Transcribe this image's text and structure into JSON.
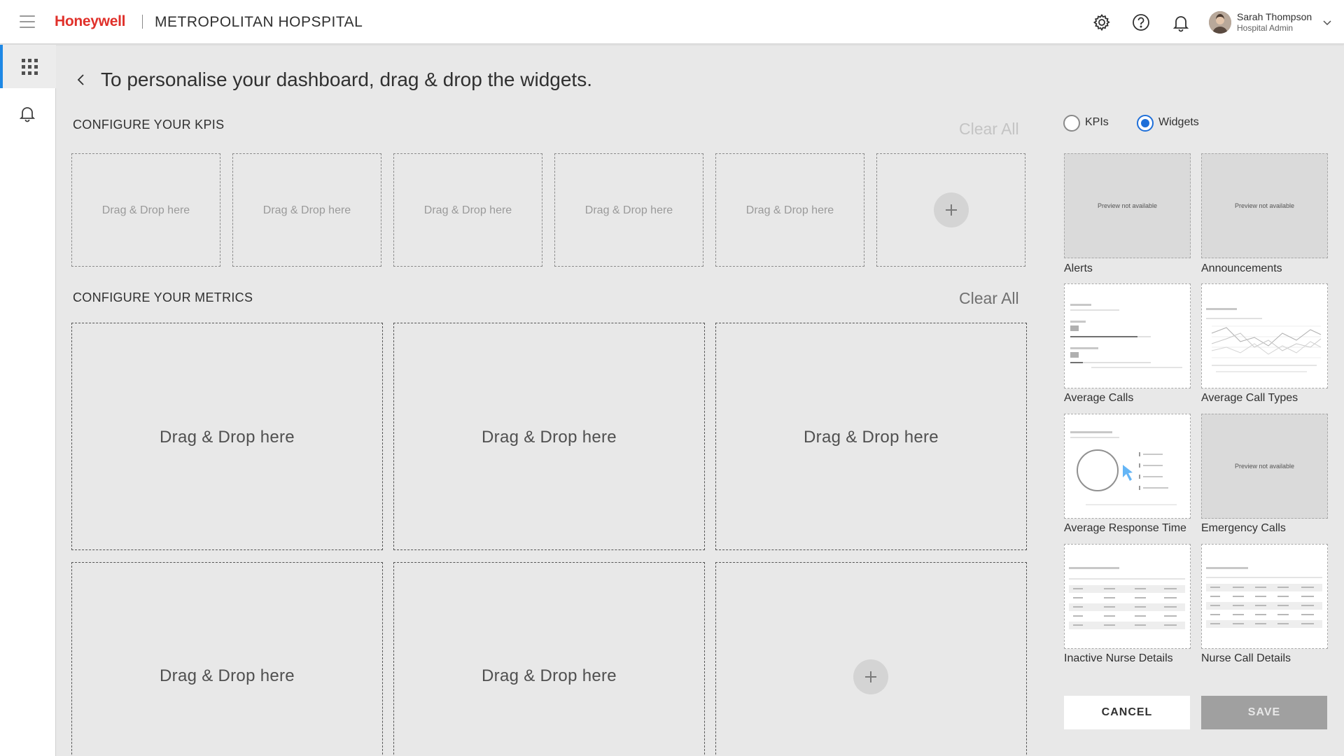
{
  "header": {
    "brand": "Honeywell",
    "hospital_name": "METROPOLITAN HOPSPITAL",
    "user": {
      "name": "Sarah Thompson",
      "role": "Hospital Admin"
    },
    "icons": [
      "gear-icon",
      "help-icon",
      "bell-icon",
      "chevron-down-icon"
    ]
  },
  "sidebar": {
    "items": [
      {
        "icon": "grid-icon",
        "active": true
      },
      {
        "icon": "bell-icon",
        "active": false
      }
    ]
  },
  "page": {
    "title": "To personalise your dashboard, drag & drop the widgets."
  },
  "kpis": {
    "title": "CONFIGURE YOUR KPIS",
    "clear_all": "Clear All",
    "clear_all_enabled": false,
    "slots": [
      "Drag & Drop here",
      "Drag & Drop here",
      "Drag & Drop here",
      "Drag & Drop here",
      "Drag & Drop here"
    ]
  },
  "metrics": {
    "title": "CONFIGURE YOUR METRICS",
    "clear_all": "Clear All",
    "clear_all_enabled": true,
    "slots": [
      "Drag & Drop here",
      "Drag & Drop here",
      "Drag & Drop here",
      "Drag & Drop here",
      "Drag & Drop here"
    ]
  },
  "panel": {
    "radio": {
      "kpis_label": "KPIs",
      "widgets_label": "Widgets",
      "selected": "Widgets"
    },
    "no_preview_text": "Preview not available",
    "widgets": [
      {
        "label": "Alerts",
        "preview": false
      },
      {
        "label": "Announcements",
        "preview": false
      },
      {
        "label": "Average Calls",
        "preview": true
      },
      {
        "label": "Average Call Types",
        "preview": true
      },
      {
        "label": "Average Response Time",
        "preview": true
      },
      {
        "label": "Emergency Calls",
        "preview": false
      },
      {
        "label": "Inactive Nurse Details",
        "preview": true
      },
      {
        "label": "Nurse Call Details",
        "preview": true
      }
    ],
    "cancel_label": "CANCEL",
    "save_label": "SAVE",
    "save_enabled": false
  },
  "colors": {
    "brand": "#e0302a",
    "accent": "#1e6fd9",
    "sidebar_active": "#1e88e5",
    "background": "#e8e8e8"
  }
}
